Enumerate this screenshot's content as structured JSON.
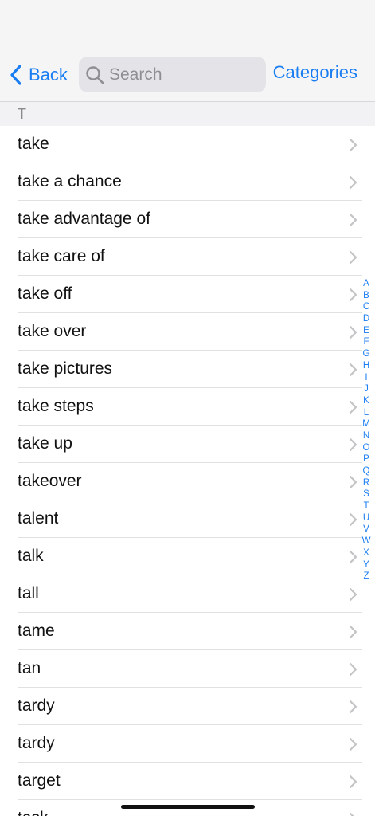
{
  "navbar": {
    "back_label": "Back",
    "search_placeholder": "Search",
    "search_value": "",
    "categories_label": "Categories",
    "accent_color": "#1a7ef2"
  },
  "section": {
    "header": "T"
  },
  "list": {
    "items": [
      "take",
      "take a chance",
      "take advantage of",
      "take care of",
      "take off",
      "take over",
      "take pictures",
      "take steps",
      "take up",
      "takeover",
      "talent",
      "talk",
      "tall",
      "tame",
      "tan",
      "tardy",
      "tardy",
      "target",
      "task"
    ],
    "row_icon": "chevron-right-icon"
  },
  "index": {
    "letters": [
      "A",
      "B",
      "C",
      "D",
      "E",
      "F",
      "G",
      "H",
      "I",
      "J",
      "K",
      "L",
      "M",
      "N",
      "O",
      "P",
      "Q",
      "R",
      "S",
      "T",
      "U",
      "V",
      "W",
      "X",
      "Y",
      "Z"
    ]
  }
}
